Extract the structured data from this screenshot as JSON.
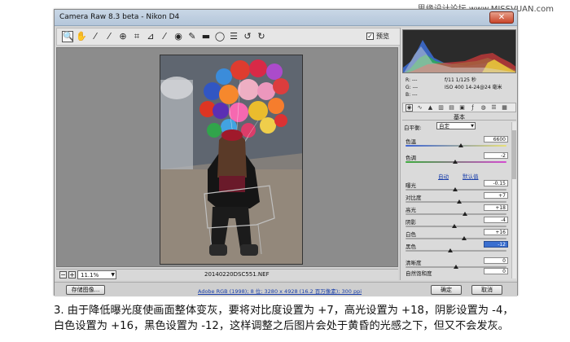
{
  "watermark": "思缘设计论坛 www.MISSVUAN.com",
  "window": {
    "title": "Camera Raw 8.3 beta - Nikon D4",
    "close_label": "✕"
  },
  "toolbar": {
    "tools": [
      {
        "name": "zoom-tool-icon",
        "glyph": "🔍"
      },
      {
        "name": "hand-tool-icon",
        "glyph": "✋"
      },
      {
        "name": "white-balance-tool-icon",
        "glyph": "⁄"
      },
      {
        "name": "color-sampler-tool-icon",
        "glyph": "⁄"
      },
      {
        "name": "targeted-adjustment-tool-icon",
        "glyph": "⊕"
      },
      {
        "name": "crop-tool-icon",
        "glyph": "⌗"
      },
      {
        "name": "straighten-tool-icon",
        "glyph": "⊿"
      },
      {
        "name": "spot-removal-tool-icon",
        "glyph": "⁄"
      },
      {
        "name": "red-eye-tool-icon",
        "glyph": "◉"
      },
      {
        "name": "adjustment-brush-icon",
        "glyph": "✎"
      },
      {
        "name": "graduated-filter-icon",
        "glyph": "▬"
      },
      {
        "name": "radial-filter-icon",
        "glyph": "◯"
      },
      {
        "name": "preferences-icon",
        "glyph": "☰"
      },
      {
        "name": "rotate-ccw-icon",
        "glyph": "↺"
      },
      {
        "name": "rotate-cw-icon",
        "glyph": "↻"
      }
    ],
    "preview_label": "预览",
    "preview_checked": true
  },
  "status": {
    "zoom_minus": "−",
    "zoom_plus": "+",
    "zoom": "11.1%",
    "filename": "20140220DSC551.NEF"
  },
  "bottom": {
    "save_button": "存储图像...",
    "workflow_link": "Adobe RGB (1998); 8 位; 3280 x 4928 (16.2 百万像素); 300 ppi",
    "ok_button": "确定",
    "cancel_button": "取消"
  },
  "panel": {
    "readout": {
      "r": "R: ---",
      "g": "G: ---",
      "b": "B: ---",
      "exif_line1": "f/11  1/125 秒",
      "exif_line2": "ISO 400  14-24@24 毫米"
    },
    "section_title": "基本",
    "white_balance": {
      "label": "白平衡:",
      "value": "自定"
    },
    "temperature": {
      "label": "色温",
      "value": "6600",
      "level": 0.55
    },
    "tint": {
      "label": "色调",
      "value": "-2",
      "level": 0.49
    },
    "auto_link": "自动",
    "default_link": "默认值",
    "exposure": {
      "label": "曝光",
      "value": "-0.15",
      "level": 0.49
    },
    "contrast": {
      "label": "对比度",
      "value": "+7",
      "level": 0.535
    },
    "highlights": {
      "label": "高光",
      "value": "+18",
      "level": 0.59
    },
    "shadows": {
      "label": "阴影",
      "value": "-4",
      "level": 0.48
    },
    "whites": {
      "label": "白色",
      "value": "+16",
      "level": 0.58
    },
    "blacks": {
      "label": "黑色",
      "value": "-12",
      "level": 0.44
    },
    "clarity": {
      "label": "清晰度",
      "value": "0",
      "level": 0.5
    },
    "vibrance": {
      "label": "自然饱和度",
      "value": "0",
      "level": 0.5
    }
  },
  "caption": {
    "line1": "3. 由于降低曝光度使画面整体变灰，要将对比度设置为 +7，高光设置为 +18，阴影设置为 -4，",
    "line2": "白色设置为 +16，黑色设置为 -12，这样调整之后图片会处于黄昏的光感之下，但又不会发灰。"
  },
  "colors": {
    "accent": "#3a6fd0",
    "link": "#1a3faa",
    "window_bg": "#d4d4d4",
    "preview_bg": "#8c8c8c"
  }
}
